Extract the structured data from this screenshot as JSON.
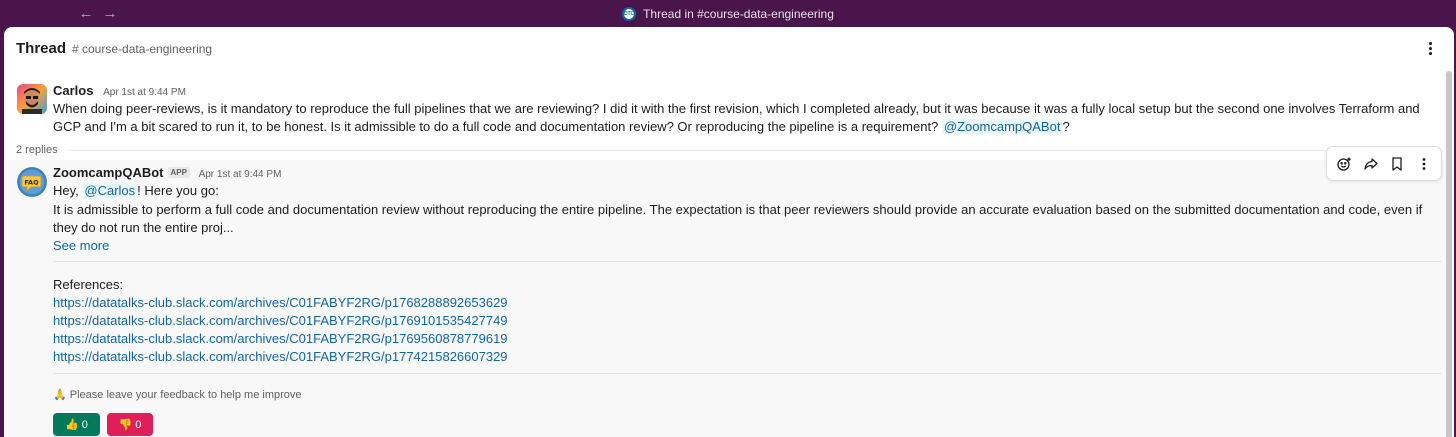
{
  "window": {
    "title": "Thread in #course-data-engineering",
    "workspace_icon_text": "DTC",
    "back_glyph": "←",
    "forward_glyph": "→"
  },
  "header": {
    "title": "Thread",
    "channel": "# course-data-engineering",
    "more_icon": "vertical-ellipsis-icon"
  },
  "messages": [
    {
      "author": "Carlos",
      "time": "Apr 1st at 9:44 PM",
      "text": "When doing peer-reviews, is it mandatory to reproduce the full pipelines that we are reviewing? I did it with the first revision, which I completed already, but it was because it was a fully local setup but the second one involves Terraform and GCP and I'm a bit scared to run it, to be honest. Is it admissible to do a full code and documentation review? Or reproducing the pipeline is a requirement?",
      "mention": "@ZoomcampQABot",
      "trailing": "?"
    }
  ],
  "replies_label": "2 replies",
  "bot": {
    "author": "ZoomcampQABot",
    "badge": "APP",
    "time": "Apr 1st at 9:44 PM",
    "avatar_text": "FAQ",
    "greeting_prefix": "Hey, ",
    "greeting_mention": "@Carlos",
    "greeting_suffix": "! Here you go:",
    "answer": "It is admissible to perform a full code and documentation review without reproducing the entire pipeline. The expectation is that peer reviewers should provide an accurate evaluation based on the submitted documentation and code, even if they do not run the entire proj...",
    "see_more": "See more",
    "references_label": "References:",
    "references": [
      "https://datatalks-club.slack.com/archives/C01FABYF2RG/p1768288892653629",
      "https://datatalks-club.slack.com/archives/C01FABYF2RG/p1769101535427749",
      "https://datatalks-club.slack.com/archives/C01FABYF2RG/p1769560878779619",
      "https://datatalks-club.slack.com/archives/C01FABYF2RG/p1774215826607329"
    ],
    "feedback_emoji": "🙏",
    "feedback_text": "Please leave your feedback to help me improve",
    "vote_up_emoji": "👍",
    "vote_up_count": "0",
    "vote_down_emoji": "👎",
    "vote_down_count": "0"
  },
  "message_toolbar": [
    "add-reaction-icon",
    "share-icon",
    "bookmark-icon",
    "more-actions-icon"
  ],
  "colors": {
    "titlebar": "#4a154b",
    "link": "#1264a3",
    "vote_up": "#007a5a",
    "vote_down": "#e01e5a",
    "mention_bg": "#e8f5fa"
  }
}
